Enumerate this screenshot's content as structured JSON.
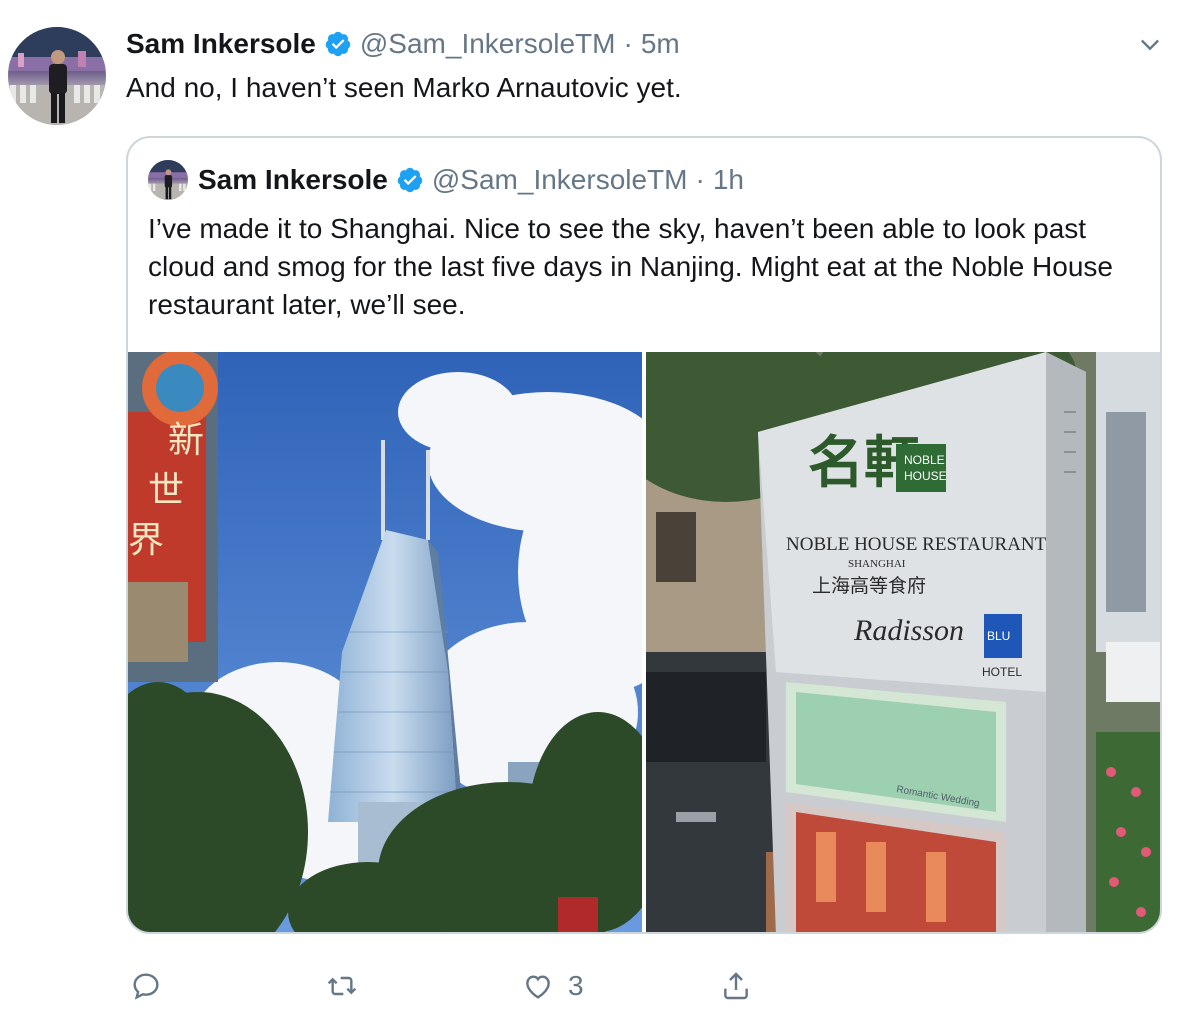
{
  "tweet": {
    "author_name": "Sam Inkersole",
    "author_handle": "@Sam_InkersoleTM",
    "separator": "·",
    "time": "5m",
    "text": "And no, I haven’t seen Marko Arnautovic yet."
  },
  "quoted_tweet": {
    "author_name": "Sam Inkersole",
    "author_handle": "@Sam_InkersoleTM",
    "separator": "·",
    "time": "1h",
    "text": "I’ve made it to Shanghai. Nice to see the sky, haven’t been able to look past cloud and smog for the last five days in Nanjing. Might eat at the Noble House restaurant later, we’ll see."
  },
  "sign": {
    "chinese_logo": "名軒",
    "badge_line1": "NOBLE",
    "badge_line2": "HOUSE",
    "restaurant": "NOBLE HOUSE RESTAURANT",
    "city": "SHANGHAI",
    "chinese_line": "上海高等食府",
    "hotel_brand": "Radisson",
    "hotel_badge": "BLU",
    "hotel": "HOTEL",
    "panel_caption": "Romantic Wedding"
  },
  "building_sign": {
    "chars": [
      "新",
      "世",
      "界"
    ]
  },
  "actions": {
    "reply_count": "",
    "retweet_count": "",
    "like_count": "3"
  },
  "colors": {
    "verified": "#1da1f2",
    "secondary_text": "#657786",
    "border": "#ccd6dd"
  },
  "icons": [
    "verified-icon",
    "caret-down-icon",
    "reply-icon",
    "retweet-icon",
    "like-icon",
    "share-icon"
  ]
}
